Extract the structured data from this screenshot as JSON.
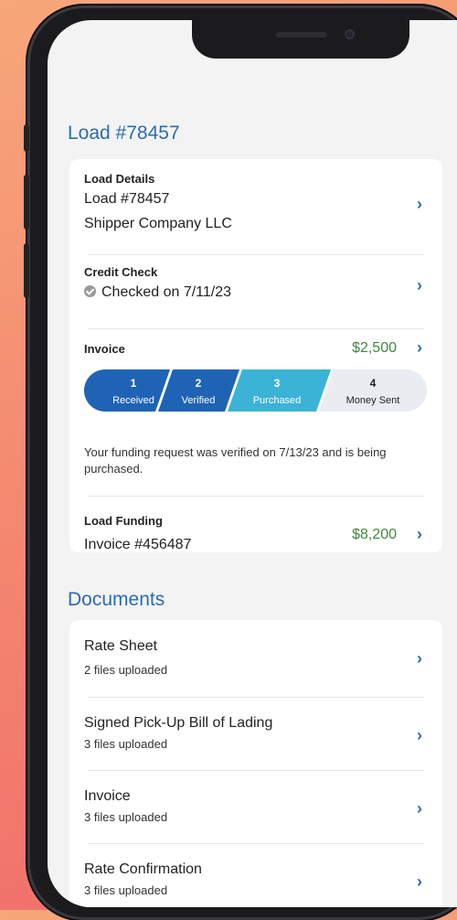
{
  "load_section": {
    "title": "Load #78457"
  },
  "load_details": {
    "label": "Load Details",
    "load_number": "Load #78457",
    "company": "Shipper Company LLC"
  },
  "credit_check": {
    "label": "Credit Check",
    "status": "Checked on 7/11/23"
  },
  "invoice": {
    "label": "Invoice",
    "amount": "$2,500",
    "steps": [
      {
        "number": "1",
        "label": "Received",
        "state": "complete"
      },
      {
        "number": "2",
        "label": "Verified",
        "state": "complete"
      },
      {
        "number": "3",
        "label": "Purchased",
        "state": "current"
      },
      {
        "number": "4",
        "label": "Money Sent",
        "state": "pending"
      }
    ],
    "message": "Your funding request was verified on 7/13/23 and is being purchased."
  },
  "load_funding": {
    "label": "Load Funding",
    "invoice_number": "Invoice #456487",
    "amount": "$8,200"
  },
  "documents_section": {
    "title": "Documents",
    "items": [
      {
        "name": "Rate Sheet",
        "status": "2 files uploaded"
      },
      {
        "name": "Signed Pick-Up Bill of Lading",
        "status": "3 files uploaded"
      },
      {
        "name": "Invoice",
        "status": "3 files uploaded"
      },
      {
        "name": "Rate Confirmation",
        "status": "3 files uploaded"
      }
    ]
  },
  "colors": {
    "accent_blue": "#2b6cb0",
    "step_dark_blue": "#1f63b4",
    "step_teal": "#3ab3d6",
    "step_pending": "#e9edf1",
    "amount_green": "#3d8a3a"
  },
  "icons": {
    "chevron": "chevron-right-icon",
    "check": "check-circle-icon"
  }
}
